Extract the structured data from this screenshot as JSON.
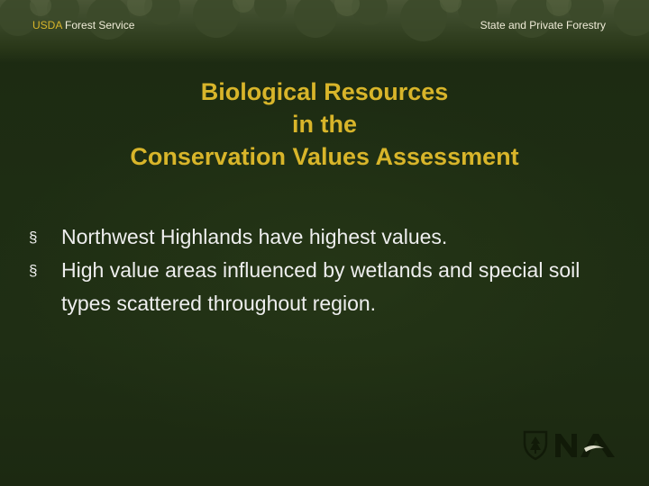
{
  "header": {
    "org_prefix": "USDA",
    "org_name": " Forest Service",
    "right_label": "State and Private Forestry"
  },
  "title": {
    "line1": "Biological Resources",
    "line2": "in the",
    "line3": "Conservation Values Assessment"
  },
  "bullets": [
    {
      "marker": "§",
      "text": "Northwest Highlands have highest values."
    },
    {
      "marker": "§",
      "text": "High value areas influenced by wetlands and special soil types scattered throughout region."
    }
  ],
  "logos": {
    "left_icon": "forest-service-shield-icon",
    "right_icon": "nia-logo-icon"
  },
  "colors": {
    "background": "#1f2c13",
    "title": "#d8b52a",
    "body_text": "#eeeeee",
    "usda": "#d8b52a"
  }
}
